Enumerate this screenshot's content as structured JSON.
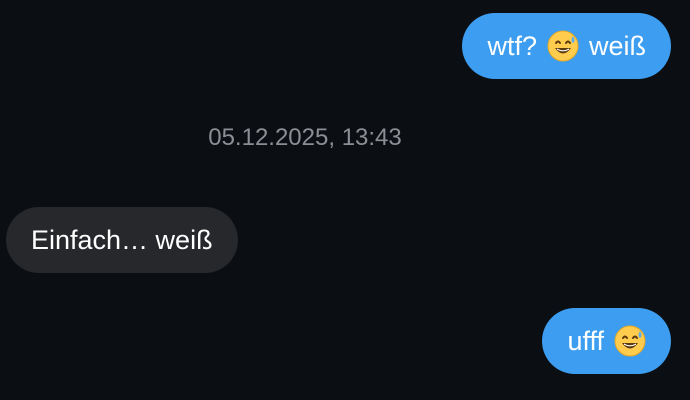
{
  "messages": [
    {
      "direction": "outgoing",
      "before": "wtf?",
      "emoji": "grinning-sweat-emoji",
      "after": "weiß"
    },
    {
      "direction": "incoming",
      "text": "Einfach… weiß"
    },
    {
      "direction": "outgoing",
      "before": "ufff",
      "emoji": "grinning-sweat-emoji"
    }
  ],
  "timestamp": "05.12.2025, 13:43",
  "colors": {
    "background": "#0b0f14",
    "outgoing_bubble": "#3d9df0",
    "incoming_bubble": "#26282b",
    "timestamp_text": "#8b8f94"
  }
}
